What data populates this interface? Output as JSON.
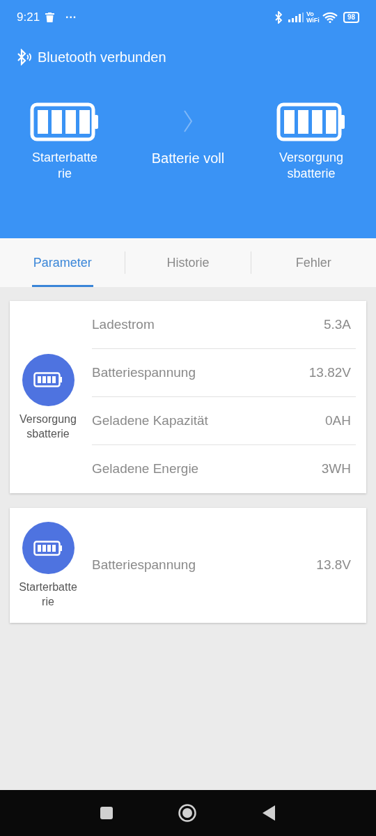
{
  "status_bar": {
    "time": "9:21",
    "more": "···",
    "vowifi_top": "Vo",
    "vowifi_bottom": "WiFi",
    "battery": "98"
  },
  "connection": {
    "text": "Bluetooth verbunden"
  },
  "header": {
    "left": {
      "lines": [
        "Starterbatte",
        "rie"
      ]
    },
    "status": "Batterie voll",
    "right": {
      "lines": [
        "Versorgung",
        "sbatterie"
      ]
    }
  },
  "tabs": [
    {
      "label": "Parameter",
      "selected": true
    },
    {
      "label": "Historie",
      "selected": false
    },
    {
      "label": "Fehler",
      "selected": false
    }
  ],
  "cards": [
    {
      "name_lines": [
        "Versorgung",
        "sbatterie"
      ],
      "rows": [
        {
          "label": "Ladestrom",
          "value": "5.3A"
        },
        {
          "label": "Batteriespannung",
          "value": "13.82V"
        },
        {
          "label": "Geladene Kapazität",
          "value": "0AH"
        },
        {
          "label": "Geladene Energie",
          "value": "3WH"
        }
      ]
    },
    {
      "name_lines": [
        "Starterbatte",
        "rie"
      ],
      "rows": [
        {
          "label": "Batteriespannung",
          "value": "13.8V"
        }
      ]
    }
  ]
}
